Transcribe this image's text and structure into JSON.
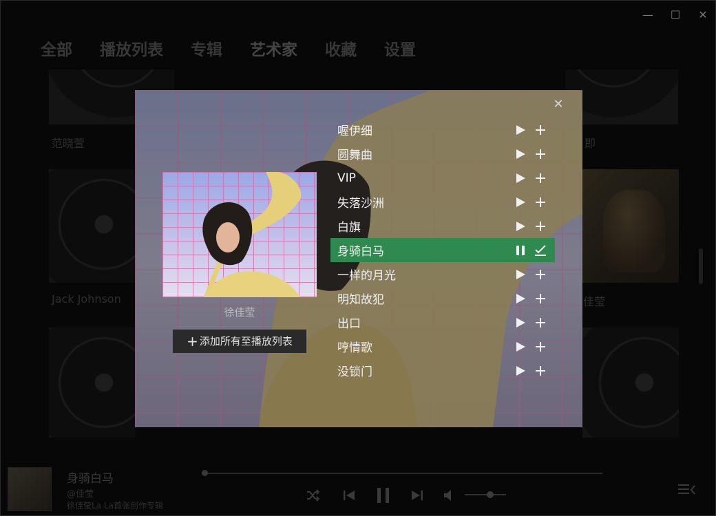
{
  "window": {
    "minimize": "—",
    "maximize": "☐",
    "close": "✕"
  },
  "nav": [
    "全部",
    "播放列表",
    "专辑",
    "艺术家",
    "收藏",
    "设置"
  ],
  "nav_active": "艺术家",
  "background_labels": {
    "top_left": "范晓萱",
    "top_right": "即",
    "mid_left": "Jack Johnson",
    "mid_right": "佳莹"
  },
  "modal": {
    "close": "✕",
    "artist": "徐佳莹",
    "add_all": "添加所有至播放列表",
    "tracks": [
      {
        "name": "喔伊细",
        "playing": false
      },
      {
        "name": "圆舞曲",
        "playing": false
      },
      {
        "name": "VIP",
        "playing": false
      },
      {
        "name": "失落沙洲",
        "playing": false
      },
      {
        "name": "白旗",
        "playing": false
      },
      {
        "name": "身骑白马",
        "playing": true
      },
      {
        "name": "一样的月光",
        "playing": false
      },
      {
        "name": "明知故犯",
        "playing": false
      },
      {
        "name": "出口",
        "playing": false
      },
      {
        "name": "哼情歌",
        "playing": false
      },
      {
        "name": "没锁门",
        "playing": false
      }
    ]
  },
  "now_playing": {
    "title": "身骑白马",
    "artist": "@佳莹",
    "album": "徐佳莹La La首张创作专辑",
    "progress": 0.0,
    "volume": 0.55
  },
  "colors": {
    "accent": "#2f8a4f"
  }
}
